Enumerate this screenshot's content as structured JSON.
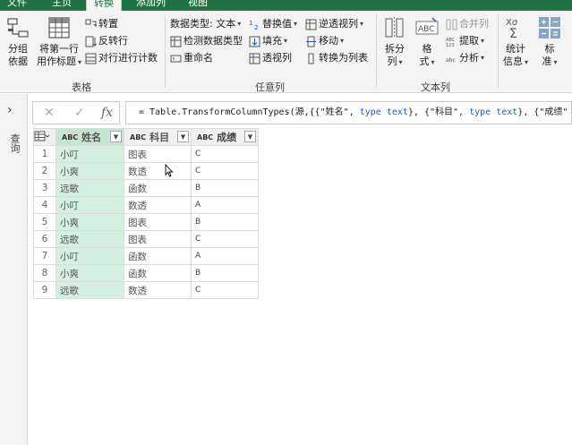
{
  "tabs": [
    {
      "label": "文件"
    },
    {
      "label": "主页"
    },
    {
      "label": "转换"
    },
    {
      "label": "添加列"
    },
    {
      "label": "视图"
    }
  ],
  "ribbon": {
    "group_table": {
      "label": "表格",
      "group_by": {
        "line1": "分组",
        "line2": "依据"
      },
      "use_first_row": {
        "line1": "将第一行",
        "line2": "用作标题"
      },
      "transpose": "转置",
      "reverse_rows": "反转行",
      "count_rows": "对行进行计数"
    },
    "group_any": {
      "label": "任意列",
      "data_type": "数据类型: 文本",
      "detect_type": "检测数据类型",
      "rename": "重命名",
      "replace_values": "替换值",
      "fill": "填充",
      "pivot_column": "透视列",
      "unpivot": "逆透视列",
      "move": "移动",
      "convert_to_list": "转换为列表"
    },
    "group_text": {
      "label": "文本列",
      "split": {
        "line1": "拆分",
        "line2": "列"
      },
      "format": {
        "line1": "格",
        "line2": "式"
      },
      "merge": "合并列",
      "extract": "提取",
      "parse": "分析"
    },
    "group_number": {
      "stats": {
        "line1": "统计",
        "line2": "信息"
      },
      "standard": {
        "line1": "标",
        "line2": "准"
      }
    }
  },
  "left_panel": {
    "label": "查询",
    "toggle": "›"
  },
  "formula_bar": {
    "cancel": "✕",
    "commit": "✓",
    "fx": "fx",
    "prefix": "= Table.TransformColumnTypes(源,{{\"姓名\", ",
    "kw1": "type text",
    "mid": "}, {\"科目\", ",
    "kw2": "type text",
    "suffix": "}, {\"成绩\""
  },
  "table": {
    "columns": [
      {
        "type": "ABC",
        "name": "姓名"
      },
      {
        "type": "ABC",
        "name": "科目"
      },
      {
        "type": "ABC",
        "name": "成绩"
      }
    ],
    "rows": [
      {
        "n": "1",
        "name": "小叮",
        "subject": "图表",
        "grade": "C"
      },
      {
        "n": "2",
        "name": "小爽",
        "subject": "数透",
        "grade": "C"
      },
      {
        "n": "3",
        "name": "远歌",
        "subject": "函数",
        "grade": "B"
      },
      {
        "n": "4",
        "name": "小叮",
        "subject": "数透",
        "grade": "A"
      },
      {
        "n": "5",
        "name": "小爽",
        "subject": "图表",
        "grade": "B"
      },
      {
        "n": "6",
        "name": "远歌",
        "subject": "图表",
        "grade": "C"
      },
      {
        "n": "7",
        "name": "小叮",
        "subject": "函数",
        "grade": "A"
      },
      {
        "n": "8",
        "name": "小爽",
        "subject": "函数",
        "grade": "B"
      },
      {
        "n": "9",
        "name": "远歌",
        "subject": "数透",
        "grade": "C"
      }
    ]
  },
  "colors": {
    "brand": "#217346",
    "selected_column": "#d5efe0",
    "keyword": "#1f58c4"
  }
}
